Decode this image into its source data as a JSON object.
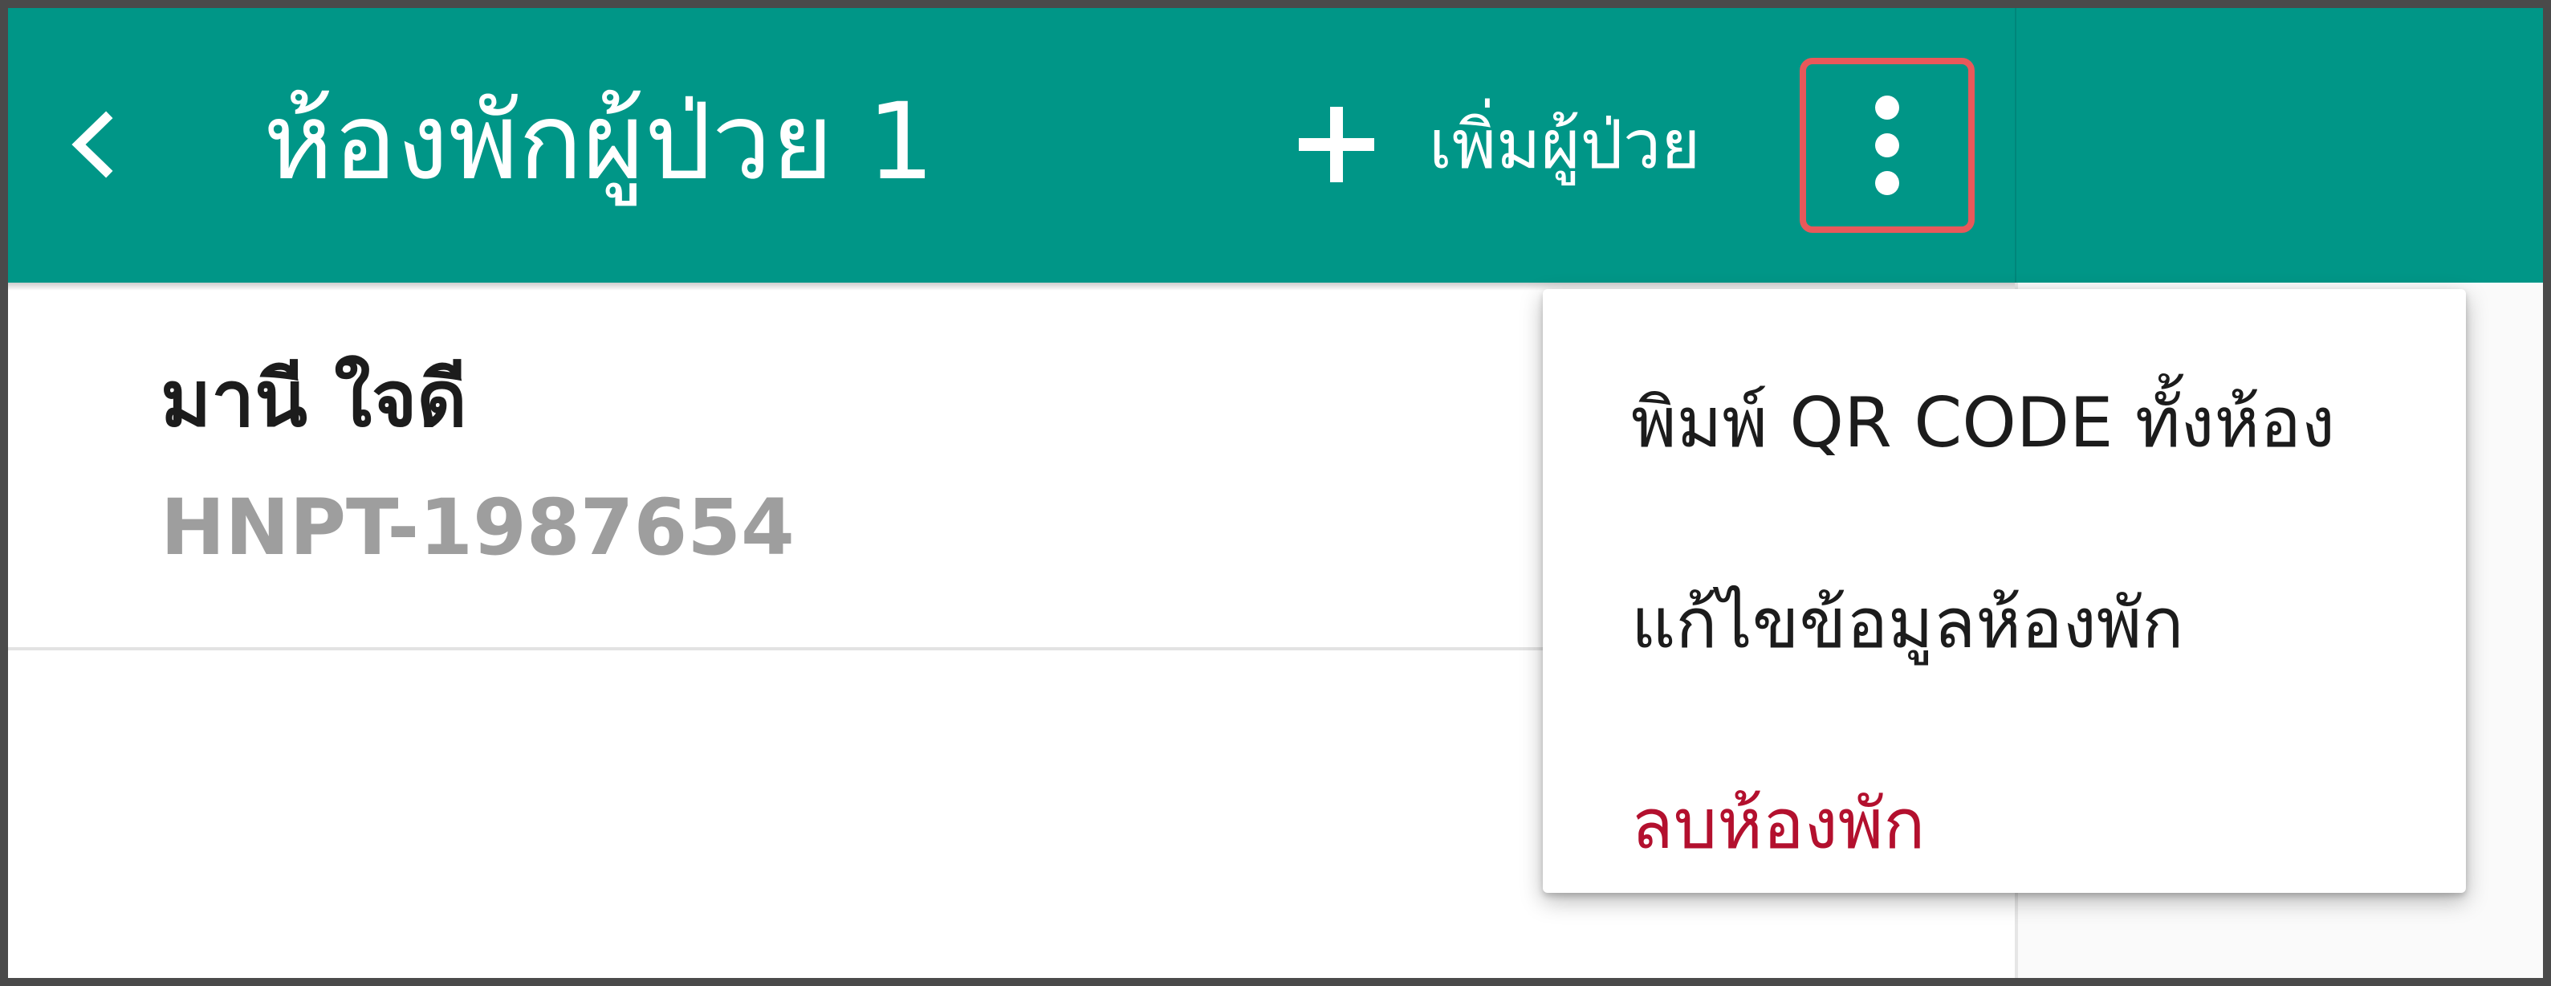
{
  "header": {
    "title": "ห้องพักผู้ป่วย 1",
    "add_patient_label": "เพิ่มผู้ป่วย",
    "back_icon": "chevron-left-icon",
    "add_icon": "plus-icon",
    "more_icon": "more-vert-icon"
  },
  "patients": [
    {
      "name": "มานี ใจดี",
      "hn": "HNPT-1987654"
    }
  ],
  "menu": {
    "items": [
      {
        "label": "พิมพ์ QR CODE ทั้งห้อง"
      },
      {
        "label": "แก้ไขข้อมูลห้องพัก"
      },
      {
        "label": "ลบห้องพัก"
      }
    ]
  },
  "colors": {
    "appbar": "#009687",
    "highlight": "#e8585a",
    "danger": "#b3102e",
    "secondary_text": "#9e9e9e"
  }
}
